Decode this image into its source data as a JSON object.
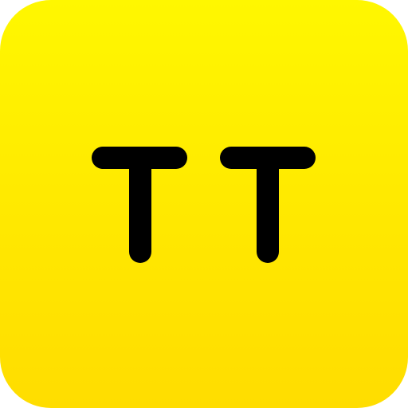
{
  "icon": {
    "name": "app-icon",
    "logo_lettering": "TT",
    "colors": {
      "background_top": "#fff700",
      "background_bottom": "#ffdd00",
      "glyph": "#000000"
    }
  }
}
